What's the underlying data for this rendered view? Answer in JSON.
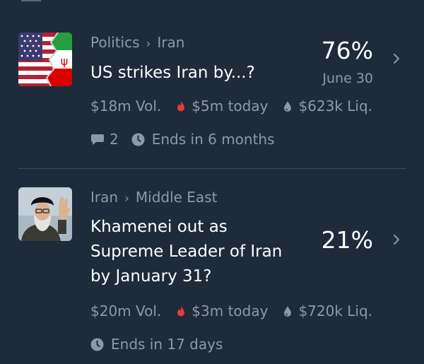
{
  "markets": [
    {
      "breadcrumbs": [
        "Politics",
        "Iran"
      ],
      "title": "US strikes Iran by...?",
      "probability": "76%",
      "date": "June 30",
      "volume": "$18m Vol.",
      "today": "$5m today",
      "liquidity": "$623k Liq.",
      "comments": "2",
      "ends": "Ends in 6 months",
      "thumbnail_icon": "us-iran-flags-icon"
    },
    {
      "breadcrumbs": [
        "Iran",
        "Middle East"
      ],
      "title": "Khamenei out as Supreme Leader of Iran by January 31?",
      "probability": "21%",
      "volume": "$20m Vol.",
      "today": "$3m today",
      "liquidity": "$720k Liq.",
      "ends": "Ends in 17 days",
      "thumbnail_icon": "khamenei-portrait"
    }
  ],
  "colors": {
    "background": "#1d2b3a",
    "muted_text": "#8c9aa7",
    "hot_icon": "#e63c3c",
    "divider": "#3b4a59"
  }
}
